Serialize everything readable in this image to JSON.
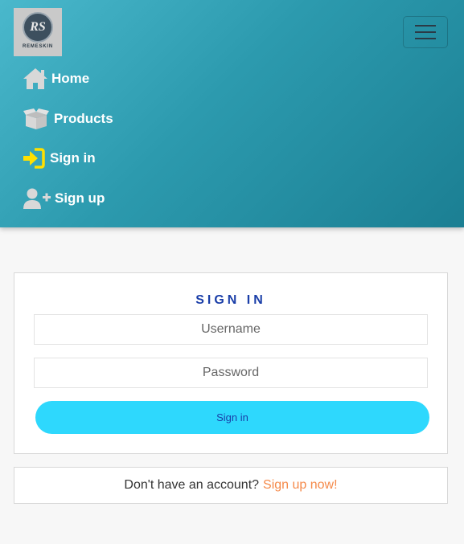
{
  "brand": {
    "logo_monogram": "RS",
    "logo_text": "REMESKIN"
  },
  "nav": {
    "items": [
      {
        "label": "Home",
        "icon": "home-icon"
      },
      {
        "label": "Products",
        "icon": "box-icon"
      },
      {
        "label": "Sign in",
        "icon": "sign-in-icon"
      },
      {
        "label": "Sign up",
        "icon": "user-plus-icon"
      }
    ]
  },
  "signin_form": {
    "title": "SIGN IN",
    "username_placeholder": "Username",
    "password_placeholder": "Password",
    "submit_label": "Sign in"
  },
  "signup_prompt": {
    "text": "Don't have an account?",
    "link_label": "Sign up now!"
  },
  "colors": {
    "navbar_gradient_start": "#4ab8cc",
    "navbar_gradient_end": "#1b7f93",
    "title_blue": "#1a3ea8",
    "button_cyan": "#2ed8fd",
    "link_orange": "#f58a4a",
    "signin_icon_yellow": "#ffe000",
    "nav_icon_gray": "#d8d8d8"
  }
}
